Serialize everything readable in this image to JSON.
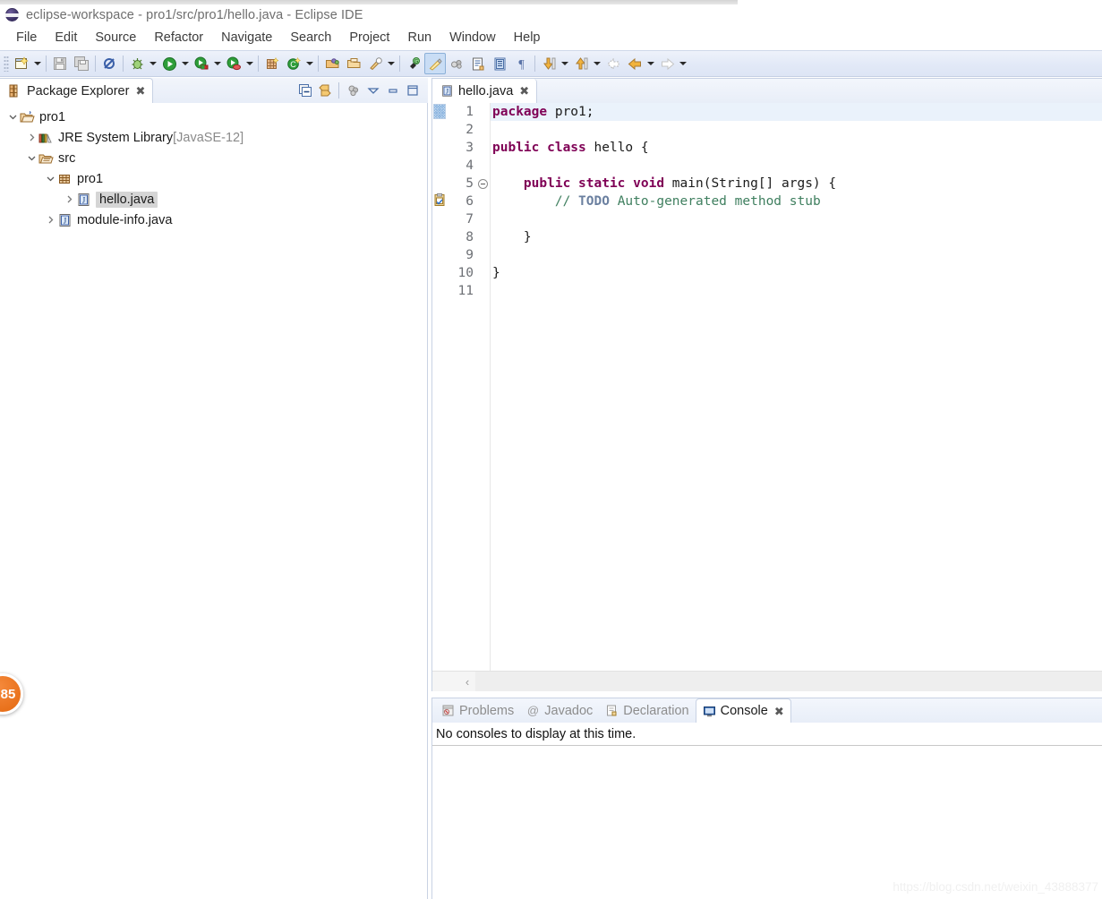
{
  "window": {
    "title": "eclipse-workspace - pro1/src/pro1/hello.java - Eclipse IDE",
    "app_icon": "eclipse-sphere-icon"
  },
  "menubar": {
    "items": [
      {
        "label": "File"
      },
      {
        "label": "Edit"
      },
      {
        "label": "Source"
      },
      {
        "label": "Refactor"
      },
      {
        "label": "Navigate"
      },
      {
        "label": "Search"
      },
      {
        "label": "Project"
      },
      {
        "label": "Run"
      },
      {
        "label": "Window"
      },
      {
        "label": "Help"
      }
    ]
  },
  "toolbar": {
    "buttons": [
      {
        "name": "new-wizard-icon",
        "tooltip": "New"
      },
      {
        "name": "save-icon",
        "tooltip": "Save"
      },
      {
        "name": "save-all-icon",
        "tooltip": "Save All"
      },
      {
        "name": "skip-all-breakpoints-icon",
        "tooltip": "Skip All Breakpoints"
      },
      {
        "name": "debug-icon",
        "tooltip": "Debug"
      },
      {
        "name": "run-icon",
        "tooltip": "Run"
      },
      {
        "name": "run-external-tools-icon",
        "tooltip": "External Tools"
      },
      {
        "name": "coverage-icon",
        "tooltip": "Coverage"
      },
      {
        "name": "new-java-project-icon",
        "tooltip": "New Java Project"
      },
      {
        "name": "new-java-class-icon",
        "tooltip": "New Java Class"
      },
      {
        "name": "open-type-icon",
        "tooltip": "Open Type"
      },
      {
        "name": "open-task-icon",
        "tooltip": "Open Task"
      },
      {
        "name": "search-icon",
        "tooltip": "Search"
      },
      {
        "name": "pin-editor-icon",
        "tooltip": "Pin Editor"
      },
      {
        "name": "toggle-mark-occurrences-icon",
        "tooltip": "Toggle Mark Occurrences"
      },
      {
        "name": "link-debug-icon",
        "tooltip": "Link"
      },
      {
        "name": "new-xml-file-icon",
        "tooltip": "New XML File"
      },
      {
        "name": "show-whitespace-icon",
        "tooltip": "Show Whitespace Characters"
      },
      {
        "name": "pilcrow-icon",
        "tooltip": "Show Print Margin"
      },
      {
        "name": "next-annotation-icon",
        "tooltip": "Next Annotation"
      },
      {
        "name": "previous-annotation-icon",
        "tooltip": "Previous Annotation"
      },
      {
        "name": "last-edit-location-icon",
        "tooltip": "Last Edit Location"
      },
      {
        "name": "back-icon",
        "tooltip": "Back"
      },
      {
        "name": "forward-icon",
        "tooltip": "Forward"
      }
    ]
  },
  "package_explorer": {
    "tab_label": "Package Explorer",
    "tab_icon": "package-explorer-icon",
    "close_glyph": "✖",
    "tools": [
      {
        "name": "collapse-all-icon",
        "tooltip": "Collapse All"
      },
      {
        "name": "link-with-editor-icon",
        "tooltip": "Link with Editor"
      },
      {
        "name": "view-filter-icon",
        "tooltip": "Filters"
      },
      {
        "name": "view-menu-icon",
        "tooltip": "View Menu"
      },
      {
        "name": "minimize-icon",
        "tooltip": "Minimize"
      },
      {
        "name": "maximize-icon",
        "tooltip": "Maximize"
      }
    ],
    "tree": [
      {
        "label": "pro1",
        "suffix": "",
        "indent": 0,
        "twisty": "expanded",
        "icon": "java-project-icon",
        "selected": false
      },
      {
        "label": "JRE System Library",
        "suffix": " [JavaSE-12]",
        "indent": 1,
        "twisty": "collapsed",
        "icon": "library-icon",
        "selected": false
      },
      {
        "label": "src",
        "suffix": "",
        "indent": 1,
        "twisty": "expanded",
        "icon": "source-folder-icon",
        "selected": false
      },
      {
        "label": "pro1",
        "suffix": "",
        "indent": 2,
        "twisty": "expanded",
        "icon": "package-icon",
        "selected": false
      },
      {
        "label": "hello.java",
        "suffix": "",
        "indent": 3,
        "twisty": "collapsed",
        "icon": "java-file-icon",
        "selected": true
      },
      {
        "label": "module-info.java",
        "suffix": "",
        "indent": 2,
        "twisty": "collapsed",
        "icon": "java-file-icon",
        "selected": false
      }
    ]
  },
  "editor": {
    "tab": {
      "label": "hello.java",
      "icon": "java-file-icon",
      "close_glyph": "✖"
    },
    "lines": [
      {
        "num": "1",
        "highlight": true,
        "fold": false,
        "marker": "cursor",
        "tokens": [
          {
            "t": "package ",
            "c": "kw"
          },
          {
            "t": "pro1;",
            "c": ""
          }
        ]
      },
      {
        "num": "2",
        "highlight": false,
        "fold": false,
        "marker": "",
        "tokens": [
          {
            "t": "",
            "c": ""
          }
        ]
      },
      {
        "num": "3",
        "highlight": false,
        "fold": false,
        "marker": "",
        "tokens": [
          {
            "t": "public class ",
            "c": "kw"
          },
          {
            "t": "hello {",
            "c": ""
          }
        ]
      },
      {
        "num": "4",
        "highlight": false,
        "fold": false,
        "marker": "",
        "tokens": [
          {
            "t": "",
            "c": ""
          }
        ]
      },
      {
        "num": "5",
        "highlight": false,
        "fold": true,
        "marker": "",
        "tokens": [
          {
            "t": "    ",
            "c": ""
          },
          {
            "t": "public static void ",
            "c": "kw"
          },
          {
            "t": "main(String[] args) {",
            "c": ""
          }
        ]
      },
      {
        "num": "6",
        "highlight": false,
        "fold": false,
        "marker": "todo",
        "tokens": [
          {
            "t": "        ",
            "c": ""
          },
          {
            "t": "// ",
            "c": "cmt"
          },
          {
            "t": "TODO",
            "c": "todo"
          },
          {
            "t": " Auto-generated method stub",
            "c": "cmt"
          }
        ]
      },
      {
        "num": "7",
        "highlight": false,
        "fold": false,
        "marker": "",
        "tokens": [
          {
            "t": "",
            "c": ""
          }
        ]
      },
      {
        "num": "8",
        "highlight": false,
        "fold": false,
        "marker": "",
        "tokens": [
          {
            "t": "    }",
            "c": ""
          }
        ]
      },
      {
        "num": "9",
        "highlight": false,
        "fold": false,
        "marker": "",
        "tokens": [
          {
            "t": "",
            "c": ""
          }
        ]
      },
      {
        "num": "10",
        "highlight": false,
        "fold": false,
        "marker": "",
        "tokens": [
          {
            "t": "}",
            "c": ""
          }
        ]
      },
      {
        "num": "11",
        "highlight": false,
        "fold": false,
        "marker": "",
        "tokens": [
          {
            "t": "",
            "c": ""
          }
        ]
      }
    ],
    "hscroll_arrow": "‹"
  },
  "console_panel": {
    "tabs": [
      {
        "label": "Problems",
        "icon": "problems-icon",
        "selected": false
      },
      {
        "label": "Javadoc",
        "icon": "javadoc-at-icon",
        "selected": false
      },
      {
        "label": "Declaration",
        "icon": "declaration-icon",
        "selected": false
      },
      {
        "label": "Console",
        "icon": "console-icon",
        "selected": true
      }
    ],
    "close_glyph": "✖",
    "message": "No consoles to display at this time."
  },
  "badge": {
    "count": "85"
  },
  "watermark": {
    "text": "https://blog.csdn.net/weixin_43888377"
  },
  "colors": {
    "keyword": "#7f0055",
    "comment": "#3f7f5f",
    "todo": "#6a7f9f",
    "line_highlight": "#eaf2fb",
    "toolbar_bg": "#e2e9f7",
    "badge_orange": "#e8701a"
  }
}
